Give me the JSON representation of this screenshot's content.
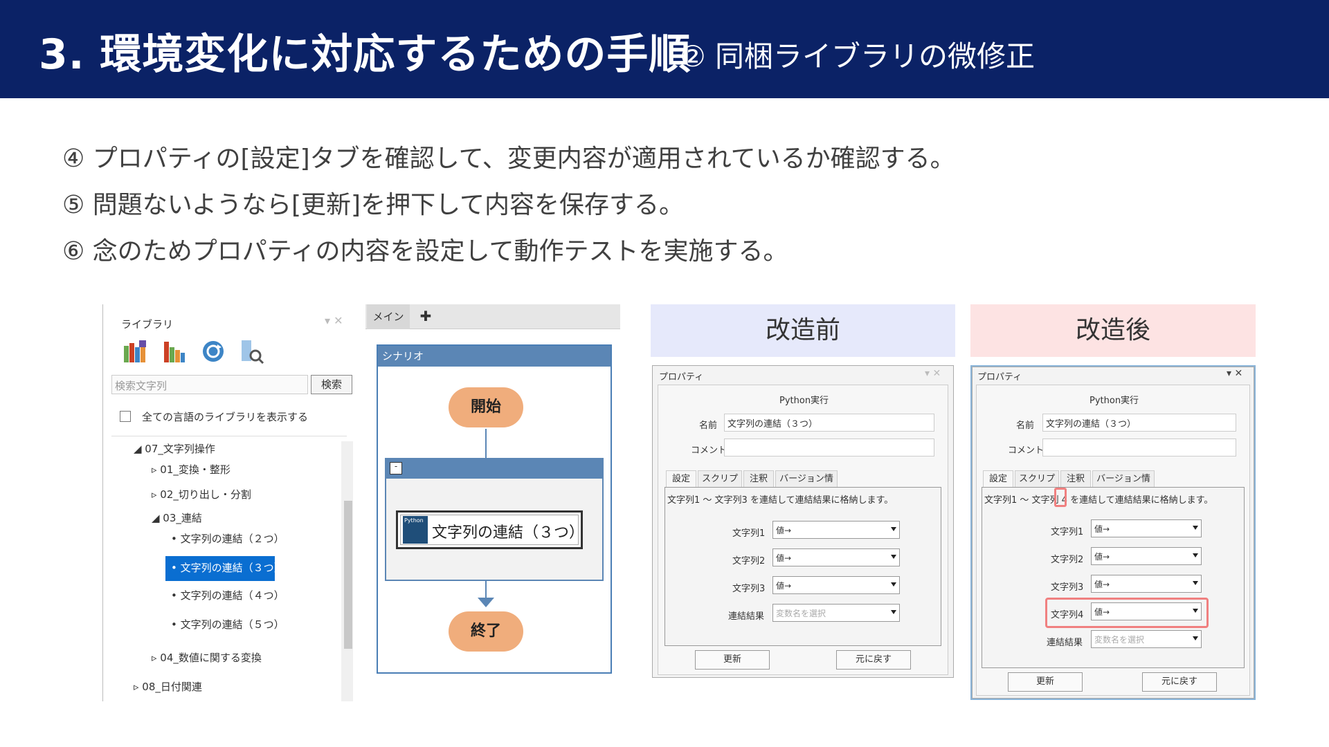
{
  "header": {
    "title": "3.  環境変化に対応するための手順",
    "subtitle": "② 同梱ライブラリの微修正"
  },
  "steps": [
    "④  プロパティの[設定]タブを確認して、変更内容が適用されているか確認する。",
    "⑤  問題ないようなら[更新]を押下して内容を保存する。",
    "⑥  念のためプロパティの内容を設定して動作テストを実施する。"
  ],
  "library": {
    "title": "ライブラリ",
    "search_placeholder": "検索文字列",
    "search_button": "検索",
    "show_all_label": "全ての言語のライブラリを表示する",
    "tree": [
      "◢ 07_文字列操作",
      "▹ 01_変換・整形",
      "▹ 02_切り出し・分割",
      "◢ 03_連結",
      "•  文字列の連結（２つ）",
      "•  文字列の連結（３つ）",
      "•  文字列の連結（４つ）",
      "•  文字列の連結（５つ）",
      "▹ 04_数値に関する変換",
      "▹ 08_日付関連"
    ],
    "icons": [
      "library-books-icon",
      "library-folder-icon",
      "refresh-icon",
      "library-search-icon"
    ]
  },
  "scenario": {
    "tab_main": "メイン",
    "tab_add": "✚",
    "header": "シナリオ",
    "start": "開始",
    "action": "文字列の連結（３つ）",
    "python_icon_label": "Python",
    "end": "終了"
  },
  "before": {
    "banner": "改造前",
    "dialog": {
      "title": "プロパティ",
      "heading": "Python実行",
      "name_label": "名前",
      "name_value": "文字列の連結（３つ）",
      "comment_label": "コメント",
      "tabs": [
        "設定",
        "スクリプト",
        "注釈",
        "バージョン情報"
      ],
      "description": "文字列1 ～ 文字列3 を連結して連結結果に格納します。",
      "fields": [
        {
          "label": "文字列1",
          "value": "値→"
        },
        {
          "label": "文字列2",
          "value": "値→"
        },
        {
          "label": "文字列3",
          "value": "値→"
        }
      ],
      "result_label": "連結結果",
      "result_placeholder": "変数名を選択",
      "update_button": "更新",
      "revert_button": "元に戻す"
    }
  },
  "after": {
    "banner": "改造後",
    "dialog": {
      "title": "プロパティ",
      "heading": "Python実行",
      "name_label": "名前",
      "name_value": "文字列の連結（３つ）",
      "comment_label": "コメント",
      "tabs": [
        "設定",
        "スクリプト",
        "注釈",
        "バージョン情報"
      ],
      "description": "文字列1 ～ 文字列 4 を連結して連結結果に格納します。",
      "fields": [
        {
          "label": "文字列1",
          "value": "値→"
        },
        {
          "label": "文字列2",
          "value": "値→"
        },
        {
          "label": "文字列3",
          "value": "値→"
        },
        {
          "label": "文字列4",
          "value": "値→"
        }
      ],
      "result_label": "連結結果",
      "result_placeholder": "変数名を選択",
      "update_button": "更新",
      "revert_button": "元に戻す"
    }
  },
  "colors": {
    "header_bg": "#0b2266",
    "selection": "#0a6ed1",
    "flow_blue": "#5b86b5",
    "terminal_orange": "#f0ad7c",
    "before_banner": "#e6e9fb",
    "after_banner": "#fde3e3",
    "highlight": "#f08080"
  }
}
